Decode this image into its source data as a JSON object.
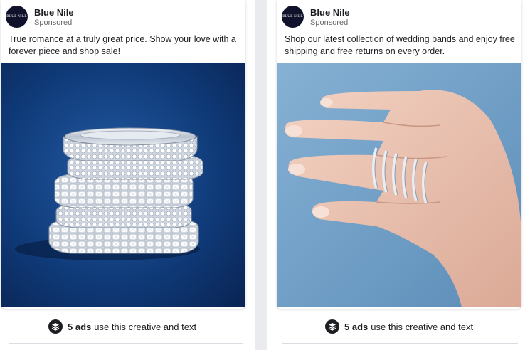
{
  "ads": [
    {
      "advertiser": "Blue Nile",
      "avatar_text": "BLUE NILE",
      "label": "Sponsored",
      "body": "True romance at a truly great price. Show your love with a forever piece and shop sale!",
      "creative_icon": "stacked-diamond-rings-image",
      "footer_count": "5 ads",
      "footer_text": "use this creative and text"
    },
    {
      "advertiser": "Blue Nile",
      "avatar_text": "BLUE NILE",
      "label": "Sponsored",
      "body": "Shop our latest collection of wedding bands and enjoy free shipping and free returns on every order.",
      "creative_icon": "hand-with-rings-image",
      "footer_count": "5 ads",
      "footer_text": "use this creative and text"
    }
  ],
  "colors": {
    "left_background": "#0f3a78",
    "right_background": "#6f9fc6",
    "avatar": "#10122c"
  }
}
